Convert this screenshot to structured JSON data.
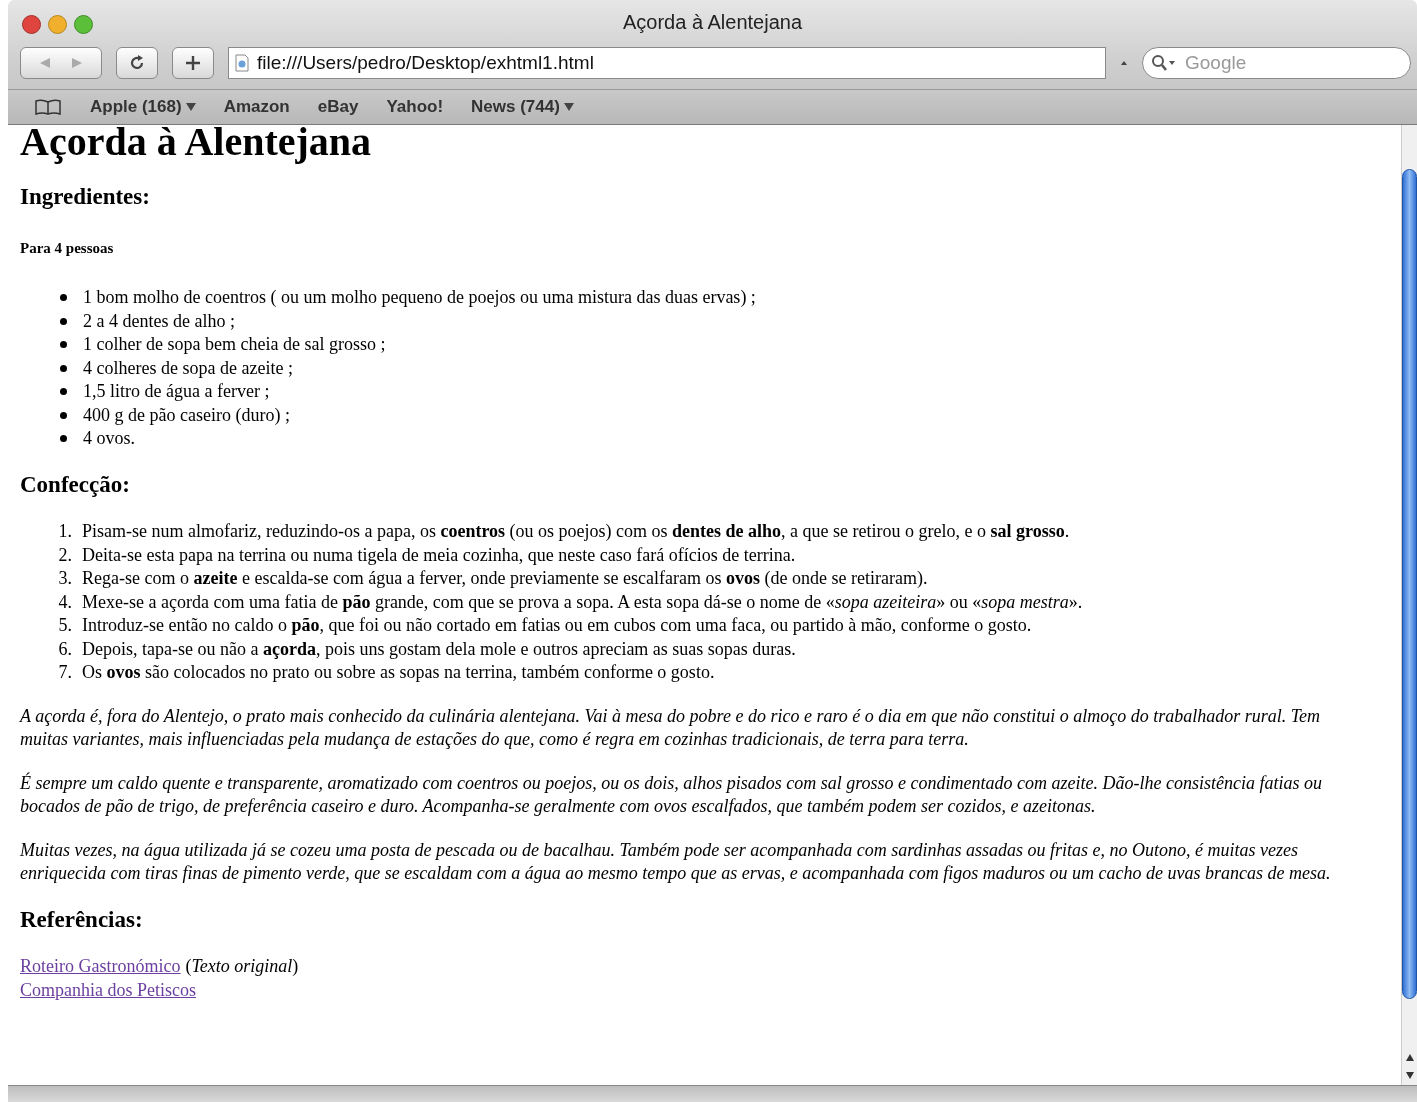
{
  "window": {
    "title": "Açorda à Alentejana"
  },
  "toolbar": {
    "address": "file:///Users/pedro/Desktop/exhtml1.html",
    "search": {
      "placeholder": "Google"
    }
  },
  "bookmarks": [
    {
      "label": "Apple (168)",
      "menu": true
    },
    {
      "label": "Amazon",
      "menu": false
    },
    {
      "label": "eBay",
      "menu": false
    },
    {
      "label": "Yahoo!",
      "menu": false
    },
    {
      "label": "News (744)",
      "menu": true
    }
  ],
  "page": {
    "title": "Açorda à Alentejana",
    "ingredients_heading": "Ingredientes:",
    "servings": "Para 4 pessoas",
    "ingredients": [
      "1 bom molho de coentros ( ou um molho pequeno de poejos ou uma mistura das duas ervas) ;",
      "2 a 4 dentes de alho ;",
      "1 colher de sopa bem cheia de sal grosso ;",
      "4 colheres de sopa de azeite ;",
      "1,5 litro de água a ferver ;",
      "400 g de pão caseiro (duro) ;",
      "4 ovos."
    ],
    "method_heading": "Confecção:",
    "steps": [
      {
        "number": "1.",
        "text": "Pisam-se num almofariz, reduzindo-os a papa, os **coentros** (ou os poejos) com os **dentes de alho**, a que se retirou o grelo, e o **sal grosso**."
      },
      {
        "number": "2.",
        "text": "Deita-se esta papa na terrina ou numa tigela de meia cozinha, que neste caso fará ofícios de terrina."
      },
      {
        "number": "3.",
        "text": "Rega-se com o **azeite** e escalda-se com água a ferver, onde previamente se escalfaram os **ovos** (de onde se retiraram)."
      },
      {
        "number": "4.",
        "text": "Mexe-se a açorda com uma fatia de **pão** grande, com que se prova a sopa. A esta sopa dá-se o nome de «*sopa azeiteira*» ou «*sopa mestra*»."
      },
      {
        "number": "5.",
        "text": "Introduz-se então no caldo o **pão**, que foi ou não cortado em fatias ou em cubos com uma faca, ou partido à mão, conforme o gosto."
      },
      {
        "number": "6.",
        "text": "Depois, tapa-se ou não a **açorda**, pois uns gostam dela mole e outros apreciam as suas sopas duras."
      },
      {
        "number": "7.",
        "text": "Os **ovos** são colocados no prato ou sobre as sopas na terrina, também conforme o gosto."
      }
    ],
    "paragraphs": [
      "A açorda é, fora do Alentejo, o prato mais conhecido da culinária alentejana. Vai à mesa do pobre e do rico e raro é o dia em que não constitui o almoço do trabalhador rural. Tem muitas variantes, mais influenciadas pela mudança de estações do que, como é regra em cozinhas tradicionais, de terra para terra.",
      "É sempre um caldo quente e transparente, aromatizado com coentros ou poejos, ou os dois, alhos pisados com sal grosso e condimentado com azeite. Dão-lhe consistência fatias ou bocados de pão de trigo, de preferência caseiro e duro. Acompanha-se geralmente com ovos escalfados, que também podem ser cozidos, e azeitonas.",
      "Muitas vezes, na água utilizada já se cozeu uma posta de pescada ou de bacalhau. Também pode ser acompanhada com sardinhas assadas ou fritas e, no Outono, é muitas vezes enriquecida com tiras finas de pimento verde, que se escaldam com a água ao mesmo tempo que as ervas, e acompanhada com figos maduros ou um cacho de uvas brancas de mesa."
    ],
    "references_heading": "Referências:",
    "references": [
      {
        "link": "Roteiro Gastronómico",
        "note": "(*Texto original*)"
      },
      {
        "link": "Companhia dos Petiscos"
      }
    ]
  }
}
